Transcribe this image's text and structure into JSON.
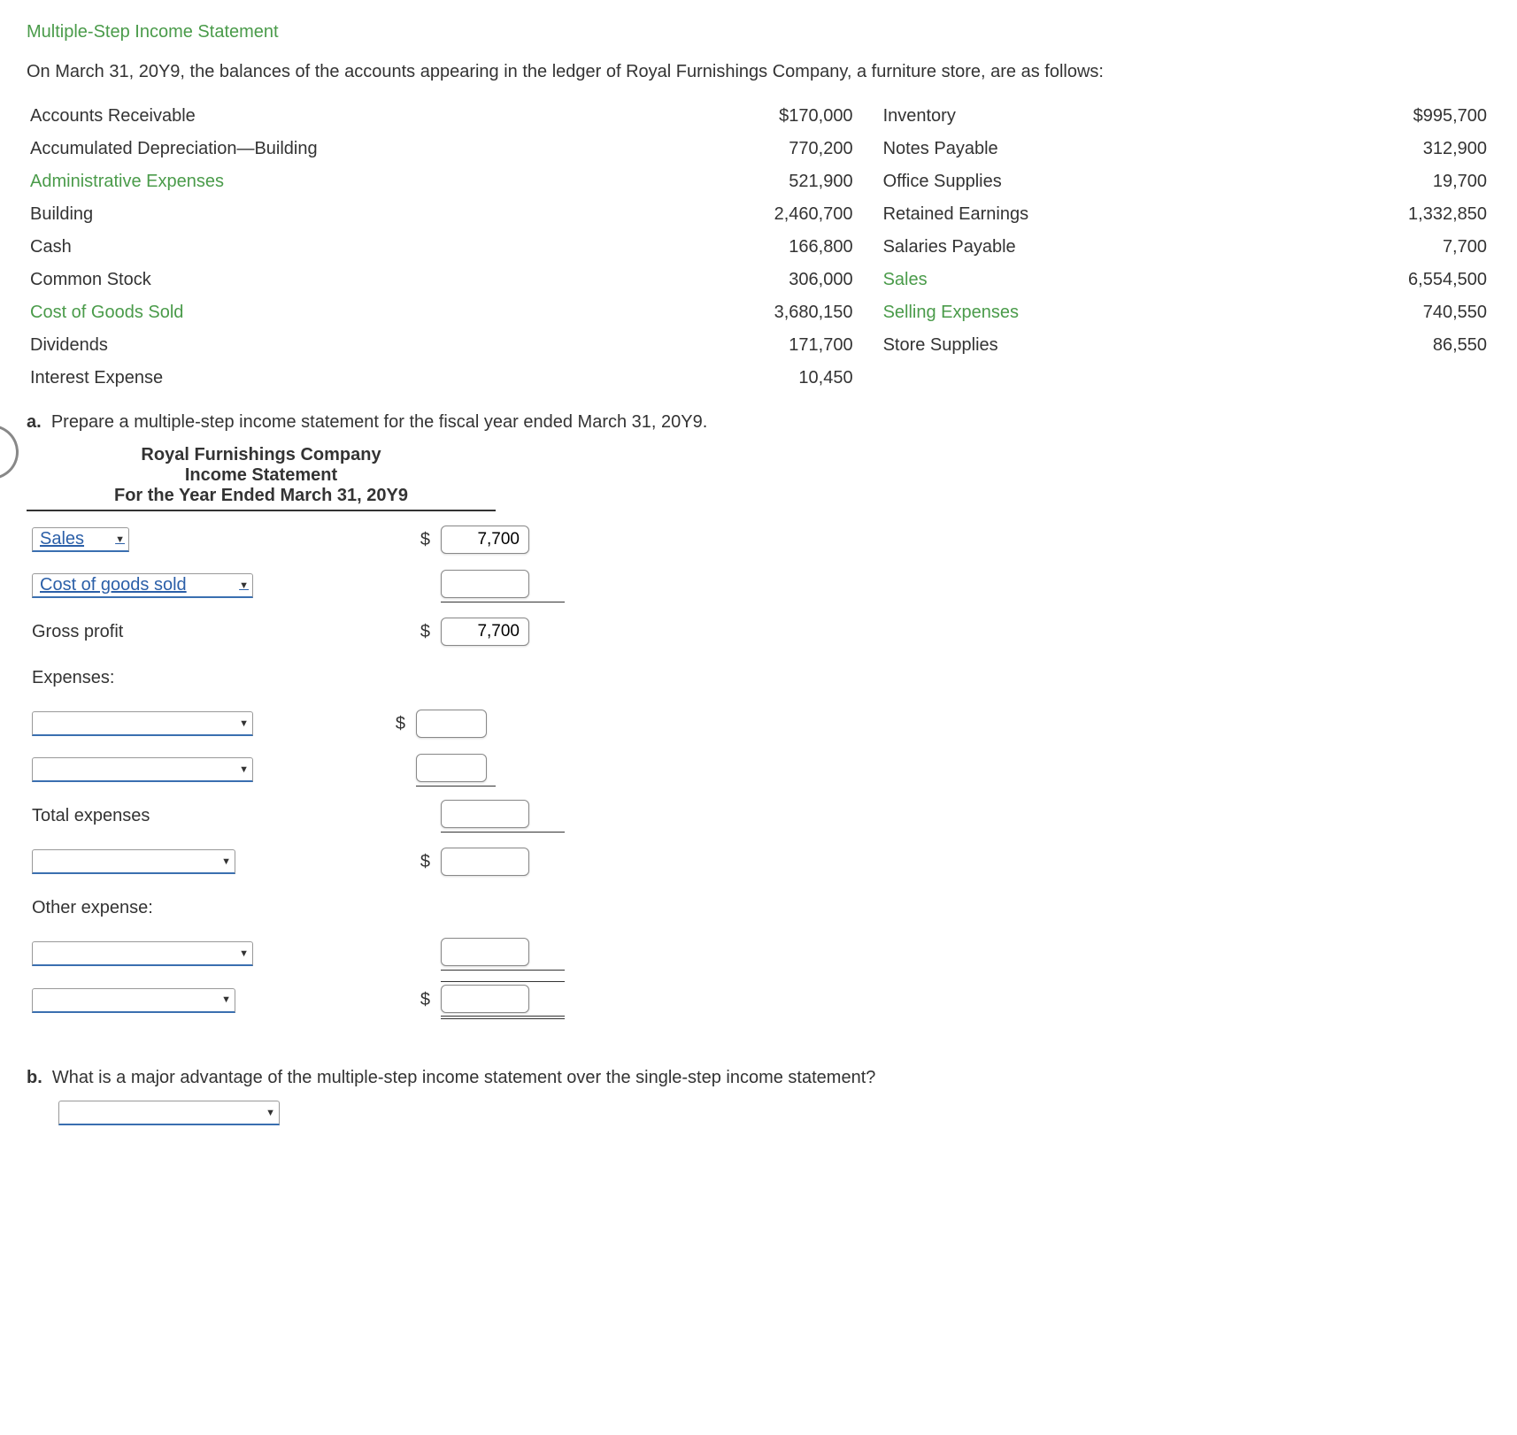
{
  "title": "Multiple-Step Income Statement",
  "intro": "On March 31, 20Y9, the balances of the accounts appearing in the ledger of Royal Furnishings Company, a furniture store, are as follows:",
  "ledger": [
    {
      "l1": "Accounts Receivable",
      "v1": "$170,000",
      "l2": "Inventory",
      "v2": "$995,700",
      "g1": false,
      "g2": false
    },
    {
      "l1": "Accumulated Depreciation—Building",
      "v1": "770,200",
      "l2": "Notes Payable",
      "v2": "312,900",
      "g1": false,
      "g2": false
    },
    {
      "l1": "Administrative Expenses",
      "v1": "521,900",
      "l2": "Office Supplies",
      "v2": "19,700",
      "g1": true,
      "g2": false
    },
    {
      "l1": "Building",
      "v1": "2,460,700",
      "l2": "Retained Earnings",
      "v2": "1,332,850",
      "g1": false,
      "g2": false
    },
    {
      "l1": "Cash",
      "v1": "166,800",
      "l2": "Salaries Payable",
      "v2": "7,700",
      "g1": false,
      "g2": false
    },
    {
      "l1": "Common Stock",
      "v1": "306,000",
      "l2": "Sales",
      "v2": "6,554,500",
      "g1": false,
      "g2": true
    },
    {
      "l1": "Cost of Goods Sold",
      "v1": "3,680,150",
      "l2": "Selling Expenses",
      "v2": "740,550",
      "g1": true,
      "g2": true
    },
    {
      "l1": "Dividends",
      "v1": "171,700",
      "l2": "Store Supplies",
      "v2": "86,550",
      "g1": false,
      "g2": false
    },
    {
      "l1": "Interest Expense",
      "v1": "10,450",
      "l2": "",
      "v2": "",
      "g1": false,
      "g2": false
    }
  ],
  "qa_marker": "a.",
  "qa_text": "Prepare a multiple-step income statement for the fiscal year ended March 31, 20Y9.",
  "stmt_header": {
    "company": "Royal Furnishings Company",
    "title": "Income Statement",
    "period": "For the Year Ended March 31, 20Y9"
  },
  "rows": {
    "sales_dd": "Sales",
    "sales_val": "7,700",
    "cogs_dd": "Cost of goods sold",
    "gross_profit_label": "Gross profit",
    "gross_profit_val": "7,700",
    "expenses_label": "Expenses:",
    "total_expenses_label": "Total expenses",
    "other_expense_label": "Other expense:"
  },
  "dollar": "$",
  "qb_marker": "b.",
  "qb_text": "What is a major advantage of the multiple-step income statement over the single-step income statement?"
}
